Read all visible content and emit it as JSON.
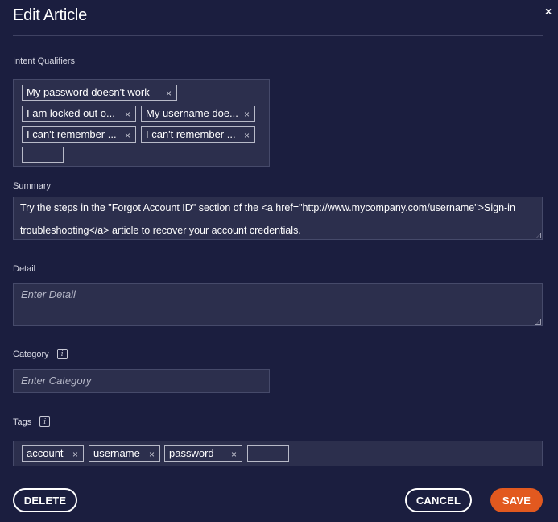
{
  "dialog": {
    "title": "Edit Article",
    "close_icon": "×"
  },
  "intent_qualifiers": {
    "label": "Intent Qualifiers",
    "chips": [
      "My password doesn't work",
      "I am locked out o...",
      "My username doe...",
      "I can't remember ...",
      "I can't remember ..."
    ],
    "remove_icon": "×"
  },
  "summary": {
    "label": "Summary",
    "value": "Try the steps in the \"Forgot Account ID\" section of the <a href=\"http://www.mycompany.com/username\">Sign-in troubleshooting</a> article to recover your account credentials."
  },
  "detail": {
    "label": "Detail",
    "placeholder": "Enter Detail"
  },
  "category": {
    "label": "Category",
    "info_icon": "i",
    "placeholder": "Enter Category"
  },
  "tags": {
    "label": "Tags",
    "info_icon": "i",
    "chips": [
      "account",
      "username",
      "password"
    ],
    "remove_icon": "×"
  },
  "buttons": {
    "delete": "DELETE",
    "cancel": "CANCEL",
    "save": "SAVE"
  },
  "colors": {
    "background": "#1b1e3f",
    "field": "#2c2f4d",
    "accent": "#e2591f"
  }
}
